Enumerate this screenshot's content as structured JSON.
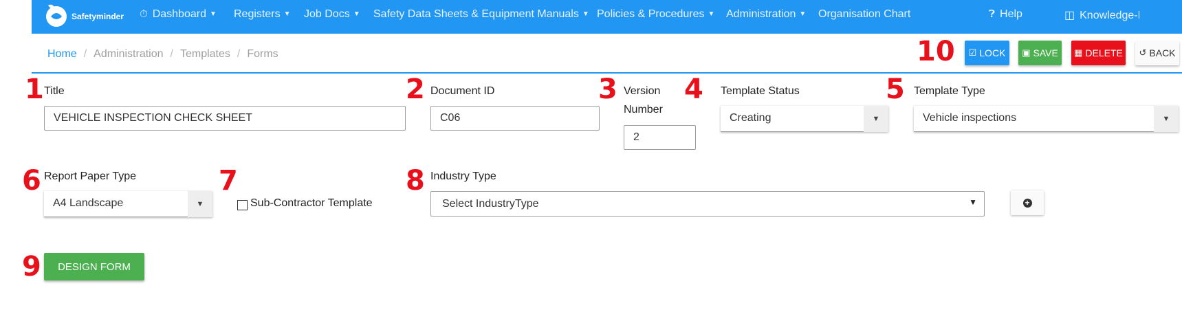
{
  "navbar": {
    "brand": "Safetyminder",
    "menu": [
      {
        "label": "Dashboard",
        "icon": "dashboard-icon"
      },
      {
        "label": "Registers"
      },
      {
        "label": "Job Docs"
      },
      {
        "label": "Safety Data Sheets & Equipment Manuals"
      },
      {
        "label": "Policies & Procedures"
      },
      {
        "label": "Administration"
      },
      {
        "label": "Organisation Chart"
      }
    ],
    "help": "Help",
    "knowledge": "Knowledge-B"
  },
  "breadcrumb": [
    "Home",
    "Administration",
    "Templates",
    "Forms"
  ],
  "actions": {
    "lock": "LOCK",
    "save": "SAVE",
    "delete": "DELETE",
    "back": "BACK"
  },
  "callouts": [
    "1",
    "2",
    "3",
    "4",
    "5",
    "6",
    "7",
    "8",
    "9",
    "10"
  ],
  "form": {
    "title": {
      "label": "Title",
      "value": "VEHICLE INSPECTION CHECK SHEET"
    },
    "document_id": {
      "label": "Document ID",
      "value": "C06"
    },
    "version": {
      "label_line1": "Version",
      "label_line2": "Number",
      "value": "2"
    },
    "template_status": {
      "label": "Template Status",
      "value": "Creating"
    },
    "template_type": {
      "label": "Template Type",
      "value": "Vehicle inspections"
    },
    "report_paper_type": {
      "label": "Report Paper Type",
      "value": "A4 Landscape"
    },
    "subcontractor": {
      "label": "Sub-Contractor Template",
      "checked": false
    },
    "industry_type": {
      "label": "Industry Type",
      "placeholder": "Select IndustryType"
    },
    "design_button": "DESIGN FORM"
  },
  "colors": {
    "nav": "#2196f3",
    "lock": "#2196f3",
    "save": "#4caf50",
    "delete": "#e8101a",
    "callout": "#e8101a"
  }
}
